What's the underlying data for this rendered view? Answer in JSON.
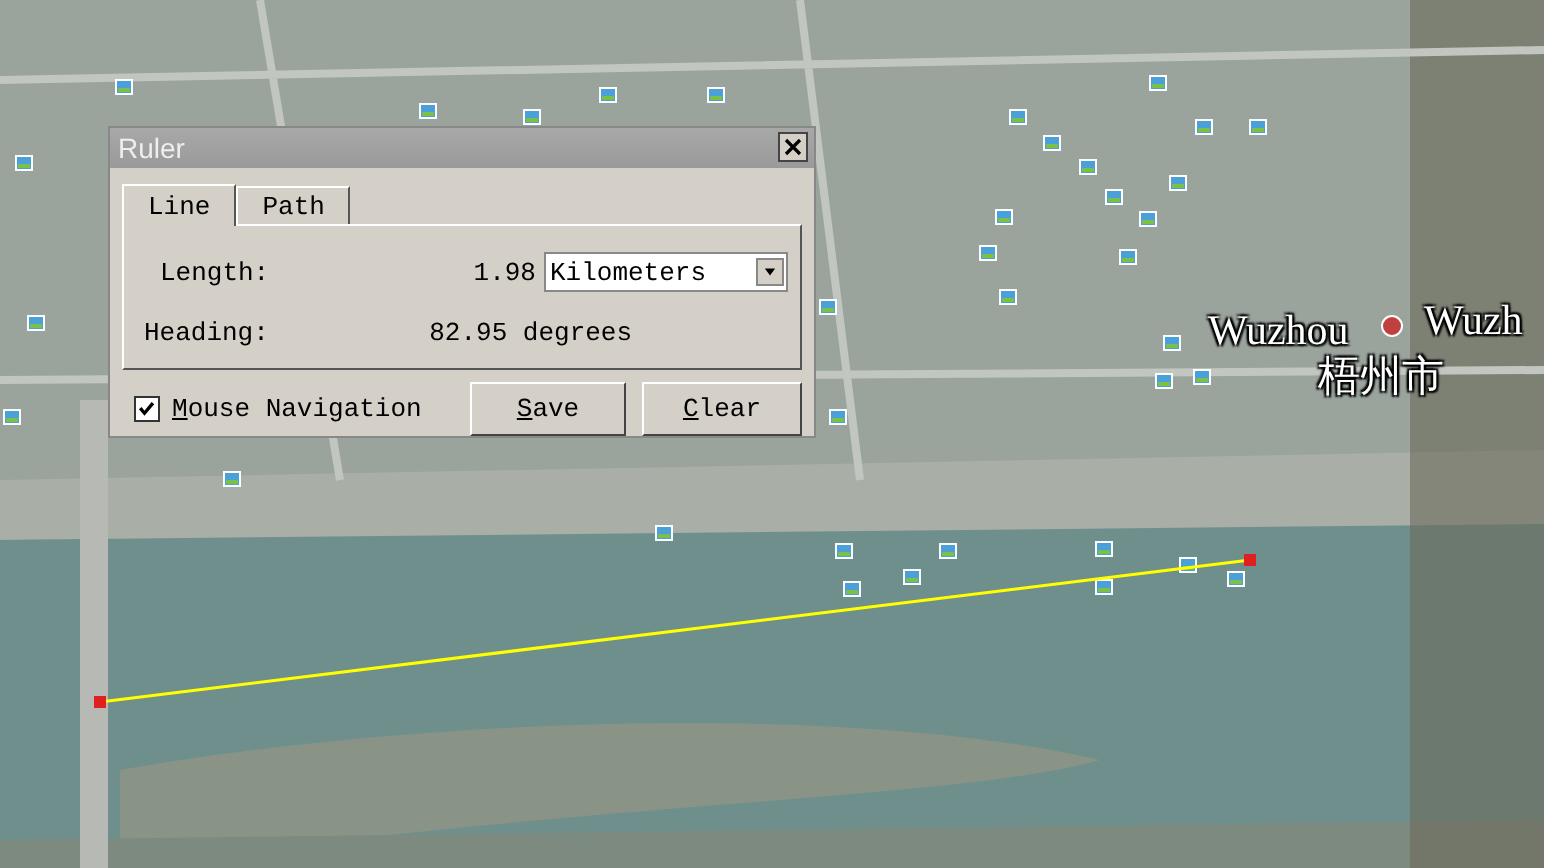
{
  "map": {
    "labels": [
      {
        "text": "Wuzhou",
        "kind": "place"
      },
      {
        "text": "梧州市",
        "kind": "place-cjk"
      },
      {
        "text": "Wuzh",
        "kind": "place"
      }
    ]
  },
  "ruler": {
    "title": "Ruler",
    "tabs": [
      {
        "label": "Line",
        "selected": true
      },
      {
        "label": "Path",
        "selected": false
      }
    ],
    "length_label": "Length:",
    "length_value": "1.98",
    "unit": "Kilometers",
    "heading_label": "Heading:",
    "heading_value": "82.95 degrees",
    "mouse_navigation": {
      "label": "Mouse Navigation",
      "checked": true
    },
    "buttons": [
      "Save",
      "Clear"
    ]
  }
}
